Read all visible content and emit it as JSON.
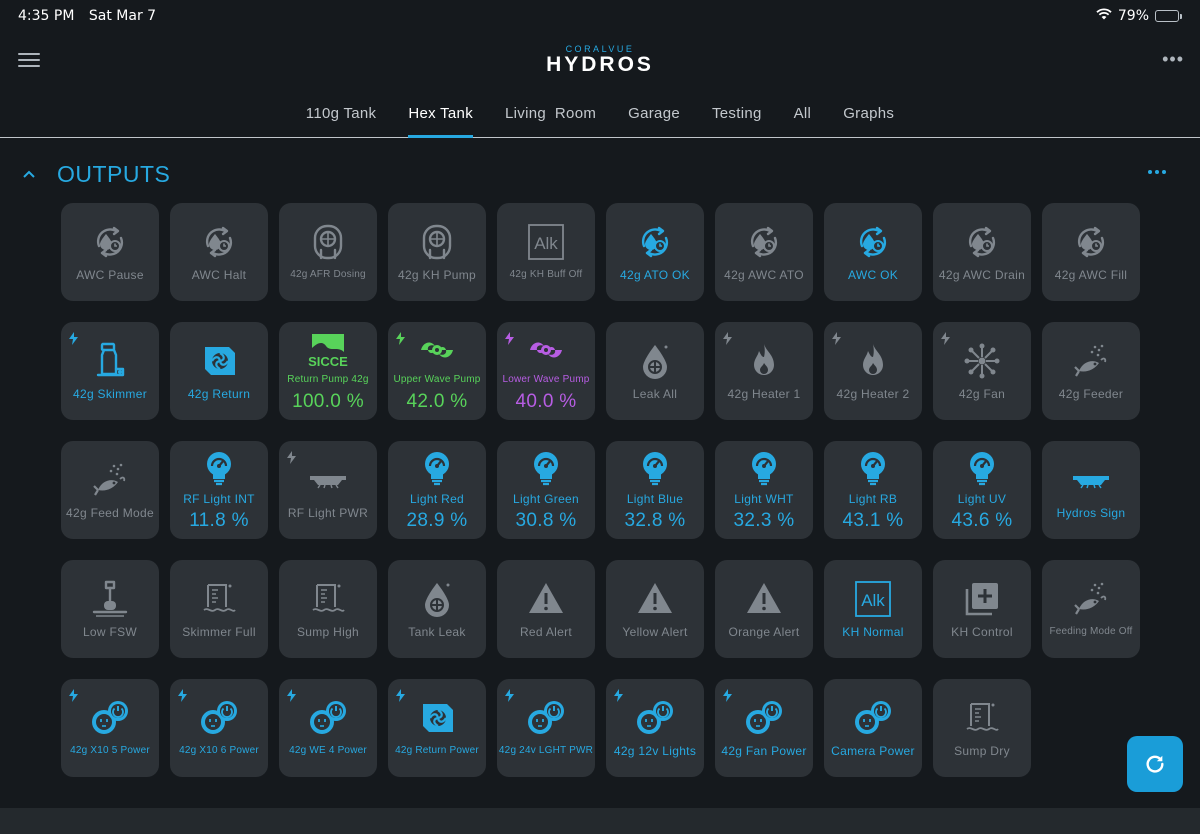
{
  "status_bar": {
    "time": "4:35 PM",
    "date": "Sat Mar 7",
    "battery": "79%",
    "battery_level": 0.79
  },
  "app": {
    "brand_top": "CORALVUE",
    "brand_main": "HYDROS"
  },
  "tabs": [
    {
      "label": "110g Tank",
      "active": false
    },
    {
      "label": "Hex Tank",
      "active": true
    },
    {
      "label": "Living  Room",
      "active": false
    },
    {
      "label": "Garage",
      "active": false
    },
    {
      "label": "Testing",
      "active": false
    },
    {
      "label": "All",
      "active": false
    },
    {
      "label": "Graphs",
      "active": false
    }
  ],
  "section": {
    "title": "OUTPUTS"
  },
  "colors": {
    "accent": "#27a9e1",
    "off": "#80878e",
    "green": "#58d35a",
    "purple": "#b75de3",
    "tile": "#2d3237",
    "background": "#15191d"
  },
  "tiles": [
    {
      "label": "AWC Pause",
      "icon": "water-cycle-icon",
      "state": "off",
      "bolt": false,
      "value": ""
    },
    {
      "label": "AWC Halt",
      "icon": "water-cycle-icon",
      "state": "off",
      "bolt": false,
      "value": ""
    },
    {
      "label": "42g AFR Dosing",
      "icon": "dosing-pump-icon",
      "state": "off",
      "bolt": false,
      "value": "",
      "small": true
    },
    {
      "label": "42g KH Pump",
      "icon": "dosing-pump-icon",
      "state": "off",
      "bolt": false,
      "value": ""
    },
    {
      "label": "42g KH Buff Off",
      "icon": "alk-icon",
      "state": "off",
      "bolt": false,
      "value": "",
      "small": true
    },
    {
      "label": "42g ATO OK",
      "icon": "water-cycle-icon",
      "state": "on",
      "bolt": false,
      "value": ""
    },
    {
      "label": "42g AWC ATO",
      "icon": "water-cycle-icon",
      "state": "off",
      "bolt": false,
      "value": ""
    },
    {
      "label": "AWC OK",
      "icon": "water-cycle-icon",
      "state": "on",
      "bolt": false,
      "value": ""
    },
    {
      "label": "42g AWC Drain",
      "icon": "water-cycle-icon",
      "state": "off",
      "bolt": false,
      "value": ""
    },
    {
      "label": "42g AWC Fill",
      "icon": "water-cycle-icon",
      "state": "off",
      "bolt": false,
      "value": ""
    },
    {
      "label": "42g Skimmer",
      "icon": "skimmer-icon",
      "state": "on",
      "bolt": true,
      "value": ""
    },
    {
      "label": "42g Return",
      "icon": "return-pump-icon",
      "state": "on",
      "bolt": false,
      "value": ""
    },
    {
      "label": "Return Pump 42g",
      "icon": "sicce-logo-icon",
      "state": "green",
      "bolt": false,
      "value": "100.0 %",
      "small": true
    },
    {
      "label": "Upper Wave Pump",
      "icon": "wave-pump-icon",
      "state": "green",
      "bolt": true,
      "value": "42.0 %",
      "small": true
    },
    {
      "label": "Lower Wave Pump",
      "icon": "wave-pump-icon",
      "state": "purple",
      "bolt": true,
      "value": "40.0 %",
      "small": true
    },
    {
      "label": "Leak All",
      "icon": "leak-icon",
      "state": "off",
      "bolt": false,
      "value": ""
    },
    {
      "label": "42g Heater 1",
      "icon": "flame-icon",
      "state": "off",
      "bolt": true,
      "value": ""
    },
    {
      "label": "42g Heater 2",
      "icon": "flame-icon",
      "state": "off",
      "bolt": true,
      "value": ""
    },
    {
      "label": "42g Fan",
      "icon": "fan-icon",
      "state": "off",
      "bolt": true,
      "value": ""
    },
    {
      "label": "42g Feeder",
      "icon": "fish-feeder-icon",
      "state": "off",
      "bolt": false,
      "value": ""
    },
    {
      "label": "42g Feed Mode",
      "icon": "fish-feeder-icon",
      "state": "off",
      "bolt": false,
      "value": ""
    },
    {
      "label": "RF Light INT",
      "icon": "light-bulb-icon",
      "state": "on",
      "bolt": false,
      "value": "11.8 %"
    },
    {
      "label": "RF Light PWR",
      "icon": "led-bar-icon",
      "state": "off",
      "bolt": true,
      "value": ""
    },
    {
      "label": "Light Red",
      "icon": "light-bulb-icon",
      "state": "on",
      "bolt": false,
      "value": "28.9 %"
    },
    {
      "label": "Light Green",
      "icon": "light-bulb-icon",
      "state": "on",
      "bolt": false,
      "value": "30.8 %"
    },
    {
      "label": "Light Blue",
      "icon": "light-bulb-icon",
      "state": "on",
      "bolt": false,
      "value": "32.8 %"
    },
    {
      "label": "Light WHT",
      "icon": "light-bulb-icon",
      "state": "on",
      "bolt": false,
      "value": "32.3 %"
    },
    {
      "label": "Light RB",
      "icon": "light-bulb-icon",
      "state": "on",
      "bolt": false,
      "value": "43.1 %"
    },
    {
      "label": "Light UV",
      "icon": "light-bulb-icon",
      "state": "on",
      "bolt": false,
      "value": "43.6 %"
    },
    {
      "label": "Hydros Sign",
      "icon": "led-bar-icon",
      "state": "on",
      "bolt": false,
      "value": ""
    },
    {
      "label": "Low FSW",
      "icon": "float-switch-icon",
      "state": "off",
      "bolt": false,
      "value": ""
    },
    {
      "label": "Skimmer Full",
      "icon": "water-level-icon",
      "state": "off",
      "bolt": false,
      "value": ""
    },
    {
      "label": "Sump High",
      "icon": "water-level-icon",
      "state": "off",
      "bolt": false,
      "value": ""
    },
    {
      "label": "Tank Leak",
      "icon": "leak-icon",
      "state": "off",
      "bolt": false,
      "value": ""
    },
    {
      "label": "Red Alert",
      "icon": "warning-icon",
      "state": "off",
      "bolt": false,
      "value": ""
    },
    {
      "label": "Yellow Alert",
      "icon": "warning-icon",
      "state": "off",
      "bolt": false,
      "value": ""
    },
    {
      "label": "Orange Alert",
      "icon": "warning-icon",
      "state": "off",
      "bolt": false,
      "value": ""
    },
    {
      "label": "KH Normal",
      "icon": "alk-icon",
      "state": "on",
      "bolt": false,
      "value": ""
    },
    {
      "label": "KH Control",
      "icon": "add-box-icon",
      "state": "off",
      "bolt": false,
      "value": ""
    },
    {
      "label": "Feeding Mode Off",
      "icon": "fish-feeder-icon",
      "state": "off",
      "bolt": false,
      "value": "",
      "small": true
    },
    {
      "label": "42g X10 5 Power",
      "icon": "power-outlet-icon",
      "state": "on",
      "bolt": true,
      "value": "",
      "small": true
    },
    {
      "label": "42g X10 6 Power",
      "icon": "power-outlet-icon",
      "state": "on",
      "bolt": true,
      "value": "",
      "small": true
    },
    {
      "label": "42g WE 4 Power",
      "icon": "power-outlet-icon",
      "state": "on",
      "bolt": true,
      "value": "",
      "small": true
    },
    {
      "label": "42g Return Power",
      "icon": "return-pump-icon",
      "state": "on",
      "bolt": true,
      "value": "",
      "small": true
    },
    {
      "label": "42g 24v LGHT PWR",
      "icon": "power-outlet-icon",
      "state": "on",
      "bolt": true,
      "value": "",
      "small": true
    },
    {
      "label": "42g 12v Lights",
      "icon": "power-outlet-icon",
      "state": "on",
      "bolt": true,
      "value": ""
    },
    {
      "label": "42g Fan Power",
      "icon": "power-outlet-icon",
      "state": "on",
      "bolt": true,
      "value": ""
    },
    {
      "label": "Camera Power",
      "icon": "power-outlet-icon",
      "state": "on",
      "bolt": false,
      "value": ""
    },
    {
      "label": "Sump Dry",
      "icon": "water-level-icon",
      "state": "off",
      "bolt": false,
      "value": ""
    }
  ],
  "fab": {
    "icon": "refresh-icon"
  }
}
